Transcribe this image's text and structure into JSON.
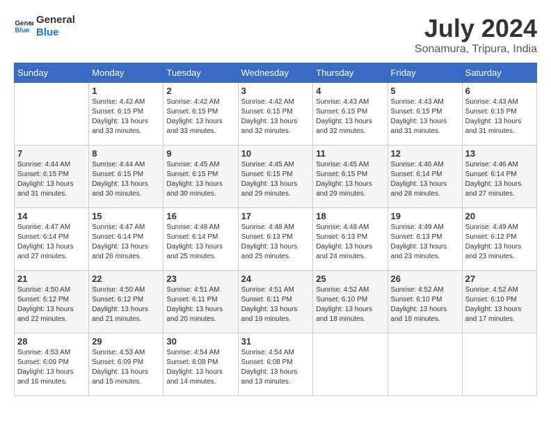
{
  "header": {
    "logo_line1": "General",
    "logo_line2": "Blue",
    "month": "July 2024",
    "location": "Sonamura, Tripura, India"
  },
  "weekdays": [
    "Sunday",
    "Monday",
    "Tuesday",
    "Wednesday",
    "Thursday",
    "Friday",
    "Saturday"
  ],
  "weeks": [
    [
      {
        "day": "",
        "sunrise": "",
        "sunset": "",
        "daylight": ""
      },
      {
        "day": "1",
        "sunrise": "Sunrise: 4:42 AM",
        "sunset": "Sunset: 6:15 PM",
        "daylight": "Daylight: 13 hours and 33 minutes."
      },
      {
        "day": "2",
        "sunrise": "Sunrise: 4:42 AM",
        "sunset": "Sunset: 6:15 PM",
        "daylight": "Daylight: 13 hours and 33 minutes."
      },
      {
        "day": "3",
        "sunrise": "Sunrise: 4:42 AM",
        "sunset": "Sunset: 6:15 PM",
        "daylight": "Daylight: 13 hours and 32 minutes."
      },
      {
        "day": "4",
        "sunrise": "Sunrise: 4:43 AM",
        "sunset": "Sunset: 6:15 PM",
        "daylight": "Daylight: 13 hours and 32 minutes."
      },
      {
        "day": "5",
        "sunrise": "Sunrise: 4:43 AM",
        "sunset": "Sunset: 6:15 PM",
        "daylight": "Daylight: 13 hours and 31 minutes."
      },
      {
        "day": "6",
        "sunrise": "Sunrise: 4:43 AM",
        "sunset": "Sunset: 6:15 PM",
        "daylight": "Daylight: 13 hours and 31 minutes."
      }
    ],
    [
      {
        "day": "7",
        "sunrise": "Sunrise: 4:44 AM",
        "sunset": "Sunset: 6:15 PM",
        "daylight": "Daylight: 13 hours and 31 minutes."
      },
      {
        "day": "8",
        "sunrise": "Sunrise: 4:44 AM",
        "sunset": "Sunset: 6:15 PM",
        "daylight": "Daylight: 13 hours and 30 minutes."
      },
      {
        "day": "9",
        "sunrise": "Sunrise: 4:45 AM",
        "sunset": "Sunset: 6:15 PM",
        "daylight": "Daylight: 13 hours and 30 minutes."
      },
      {
        "day": "10",
        "sunrise": "Sunrise: 4:45 AM",
        "sunset": "Sunset: 6:15 PM",
        "daylight": "Daylight: 13 hours and 29 minutes."
      },
      {
        "day": "11",
        "sunrise": "Sunrise: 4:45 AM",
        "sunset": "Sunset: 6:15 PM",
        "daylight": "Daylight: 13 hours and 29 minutes."
      },
      {
        "day": "12",
        "sunrise": "Sunrise: 4:46 AM",
        "sunset": "Sunset: 6:14 PM",
        "daylight": "Daylight: 13 hours and 28 minutes."
      },
      {
        "day": "13",
        "sunrise": "Sunrise: 4:46 AM",
        "sunset": "Sunset: 6:14 PM",
        "daylight": "Daylight: 13 hours and 27 minutes."
      }
    ],
    [
      {
        "day": "14",
        "sunrise": "Sunrise: 4:47 AM",
        "sunset": "Sunset: 6:14 PM",
        "daylight": "Daylight: 13 hours and 27 minutes."
      },
      {
        "day": "15",
        "sunrise": "Sunrise: 4:47 AM",
        "sunset": "Sunset: 6:14 PM",
        "daylight": "Daylight: 13 hours and 26 minutes."
      },
      {
        "day": "16",
        "sunrise": "Sunrise: 4:48 AM",
        "sunset": "Sunset: 6:14 PM",
        "daylight": "Daylight: 13 hours and 25 minutes."
      },
      {
        "day": "17",
        "sunrise": "Sunrise: 4:48 AM",
        "sunset": "Sunset: 6:13 PM",
        "daylight": "Daylight: 13 hours and 25 minutes."
      },
      {
        "day": "18",
        "sunrise": "Sunrise: 4:48 AM",
        "sunset": "Sunset: 6:13 PM",
        "daylight": "Daylight: 13 hours and 24 minutes."
      },
      {
        "day": "19",
        "sunrise": "Sunrise: 4:49 AM",
        "sunset": "Sunset: 6:13 PM",
        "daylight": "Daylight: 13 hours and 23 minutes."
      },
      {
        "day": "20",
        "sunrise": "Sunrise: 4:49 AM",
        "sunset": "Sunset: 6:12 PM",
        "daylight": "Daylight: 13 hours and 23 minutes."
      }
    ],
    [
      {
        "day": "21",
        "sunrise": "Sunrise: 4:50 AM",
        "sunset": "Sunset: 6:12 PM",
        "daylight": "Daylight: 13 hours and 22 minutes."
      },
      {
        "day": "22",
        "sunrise": "Sunrise: 4:50 AM",
        "sunset": "Sunset: 6:12 PM",
        "daylight": "Daylight: 13 hours and 21 minutes."
      },
      {
        "day": "23",
        "sunrise": "Sunrise: 4:51 AM",
        "sunset": "Sunset: 6:11 PM",
        "daylight": "Daylight: 13 hours and 20 minutes."
      },
      {
        "day": "24",
        "sunrise": "Sunrise: 4:51 AM",
        "sunset": "Sunset: 6:11 PM",
        "daylight": "Daylight: 13 hours and 19 minutes."
      },
      {
        "day": "25",
        "sunrise": "Sunrise: 4:52 AM",
        "sunset": "Sunset: 6:10 PM",
        "daylight": "Daylight: 13 hours and 18 minutes."
      },
      {
        "day": "26",
        "sunrise": "Sunrise: 4:52 AM",
        "sunset": "Sunset: 6:10 PM",
        "daylight": "Daylight: 13 hours and 18 minutes."
      },
      {
        "day": "27",
        "sunrise": "Sunrise: 4:52 AM",
        "sunset": "Sunset: 6:10 PM",
        "daylight": "Daylight: 13 hours and 17 minutes."
      }
    ],
    [
      {
        "day": "28",
        "sunrise": "Sunrise: 4:53 AM",
        "sunset": "Sunset: 6:09 PM",
        "daylight": "Daylight: 13 hours and 16 minutes."
      },
      {
        "day": "29",
        "sunrise": "Sunrise: 4:53 AM",
        "sunset": "Sunset: 6:09 PM",
        "daylight": "Daylight: 13 hours and 15 minutes."
      },
      {
        "day": "30",
        "sunrise": "Sunrise: 4:54 AM",
        "sunset": "Sunset: 6:08 PM",
        "daylight": "Daylight: 13 hours and 14 minutes."
      },
      {
        "day": "31",
        "sunrise": "Sunrise: 4:54 AM",
        "sunset": "Sunset: 6:08 PM",
        "daylight": "Daylight: 13 hours and 13 minutes."
      },
      {
        "day": "",
        "sunrise": "",
        "sunset": "",
        "daylight": ""
      },
      {
        "day": "",
        "sunrise": "",
        "sunset": "",
        "daylight": ""
      },
      {
        "day": "",
        "sunrise": "",
        "sunset": "",
        "daylight": ""
      }
    ]
  ]
}
